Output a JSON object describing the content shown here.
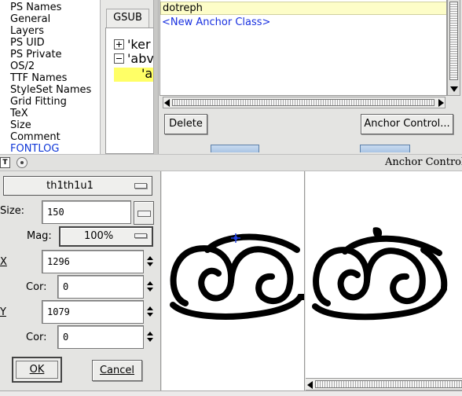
{
  "font_info": {
    "sections": [
      "PS Names",
      "General",
      "Layers",
      "PS UID",
      "PS Private",
      "OS/2",
      "TTF Names",
      "StyleSet Names",
      "Grid Fitting",
      "TeX",
      "Size",
      "Comment",
      "FONTLOG"
    ],
    "tab_label": "GSUB",
    "tree_items": [
      "'ker",
      "'abv",
      "'a"
    ]
  },
  "anchor_classes": {
    "selected": "dotreph",
    "new_item": "<New Anchor Class>",
    "delete_label": "Delete",
    "anchor_control_label": "Anchor Control..."
  },
  "window": {
    "title": "Anchor Control fo",
    "icon_label": "T"
  },
  "anchor_control": {
    "glyph": "th1th1u1",
    "size_label": "Size:",
    "size_value": "150",
    "mag_label": "Mag:",
    "mag_value": "100%",
    "x_label": "X",
    "x_value": "1296",
    "cor_label": "Cor:",
    "x_cor_value": "0",
    "y_label": "Y",
    "y_value": "1079",
    "y_cor_value": "0",
    "ok_label": "OK",
    "cancel_label": "Cancel"
  },
  "colors": {
    "selection_yellow": "#ffff66",
    "anchor_blue": "#2040e0",
    "link_blue": "#1830e0"
  },
  "icons": [
    "plus-box-icon",
    "minus-box-icon",
    "anchor-cross-icon",
    "anchor-dot-icon",
    "menu-button-icon"
  ]
}
